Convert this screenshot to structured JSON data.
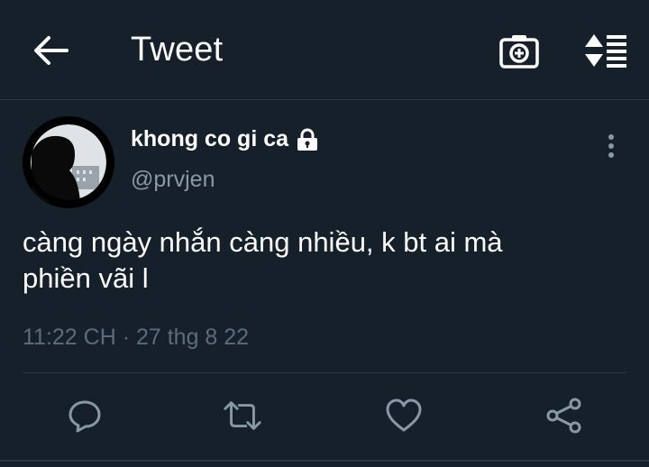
{
  "header": {
    "title": "Tweet",
    "back_icon": "arrow-left-icon",
    "camera_icon": "camera-add-icon",
    "sort_icon": "sort-list-icon"
  },
  "tweet": {
    "author_name": "khong co gi ca",
    "author_handle": "@prvjen",
    "protected_icon": "lock-icon",
    "text_line1": "càng ngày nhắn càng nhiều, k bt ai mà",
    "text_line2": "phiền vãi l",
    "timestamp": "11:22 CH · 27 thg 8 22"
  },
  "actions": [
    "reply-icon",
    "retweet-icon",
    "heart-icon",
    "share-icon"
  ],
  "colors": {
    "background": "#15202b",
    "text": "#ffffff",
    "secondary": "#8899a6",
    "icon": "#8899a6"
  }
}
